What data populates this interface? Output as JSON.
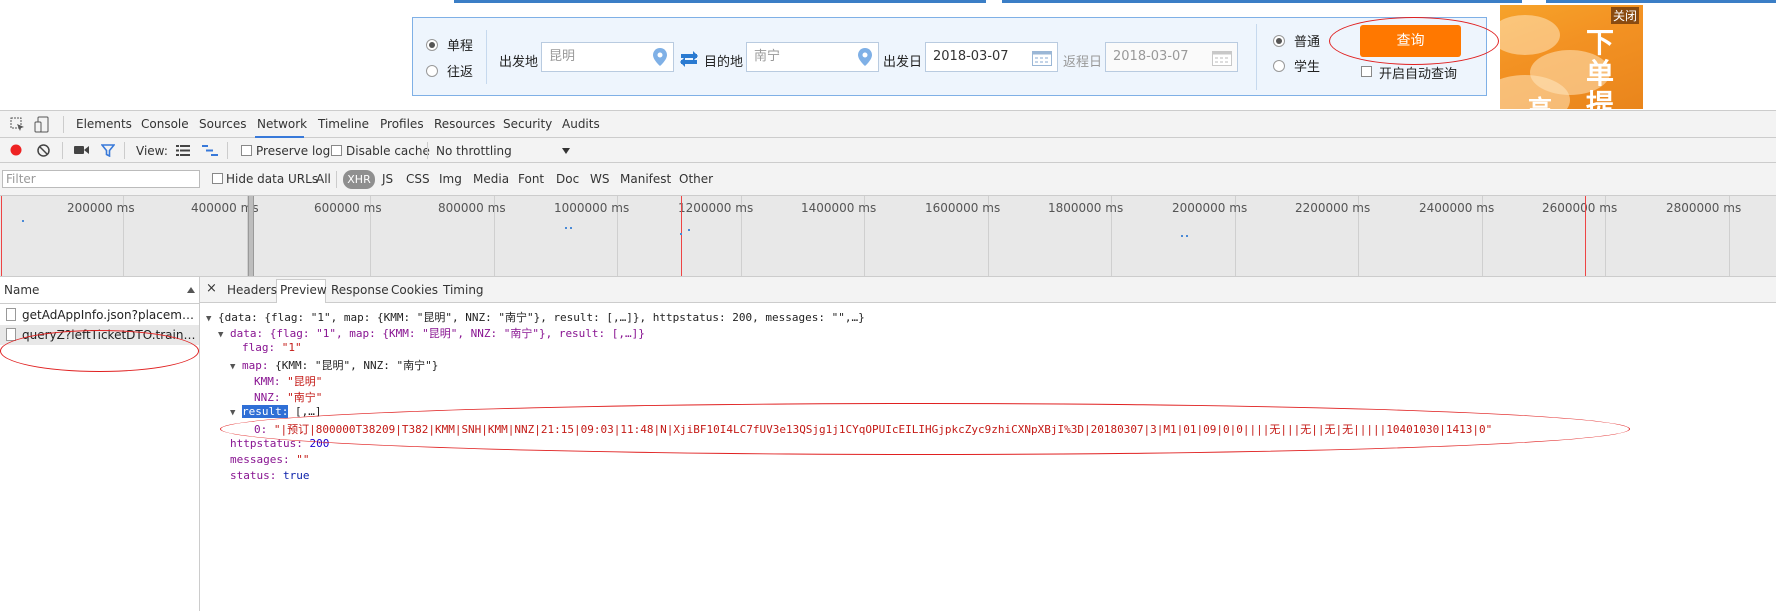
{
  "search": {
    "trip_one_way": "单程",
    "trip_round": "往返",
    "from_label": "出发地",
    "from_value": "昆明",
    "to_label": "目的地",
    "to_value": "南宁",
    "depart_label": "出发日",
    "depart_value": "2018-03-07",
    "return_label": "返程日",
    "return_value": "2018-03-07",
    "ticket_normal": "普通",
    "ticket_student": "学生",
    "query_label": "查询",
    "auto_query_label": "开启自动查询",
    "accent": "#ff7800"
  },
  "ad": {
    "close_label": "关闭",
    "text_1": "下",
    "text_2": "单",
    "text_3": "提",
    "text_4": "高"
  },
  "devtools": {
    "tabs": [
      "Elements",
      "Console",
      "Sources",
      "Network",
      "Timeline",
      "Profiles",
      "Resources",
      "Security",
      "Audits"
    ],
    "active_tab": "Network",
    "toolbar": {
      "view_label": "View:",
      "preserve_log": "Preserve log",
      "disable_cache": "Disable cache",
      "throttling": "No throttling"
    },
    "filter": {
      "placeholder": "Filter",
      "hide_data_urls": "Hide data URLs",
      "types": [
        "All",
        "XHR",
        "JS",
        "CSS",
        "Img",
        "Media",
        "Font",
        "Doc",
        "WS",
        "Manifest",
        "Other"
      ],
      "active_type": "XHR"
    },
    "timeline_ticks": [
      "200000 ms",
      "400000 ms",
      "600000 ms",
      "800000 ms",
      "1000000 ms",
      "1200000 ms",
      "1400000 ms",
      "1600000 ms",
      "1800000 ms",
      "2000000 ms",
      "2200000 ms",
      "2400000 ms",
      "2600000 ms",
      "2800000 ms"
    ],
    "name_header": "Name",
    "requests": [
      "getAdAppInfo.json?placement...",
      "queryZ?leftTicketDTO.train_dat..."
    ],
    "detail_tabs": [
      "Headers",
      "Preview",
      "Response",
      "Cookies",
      "Timing"
    ],
    "active_detail_tab": "Preview",
    "preview": {
      "line1": "{data: {flag: \"1\", map: {KMM: \"昆明\", NNZ: \"南宁\"}, result: [,…]}, httpstatus: 200, messages: \"\",…}",
      "line2": "data: {flag: \"1\", map: {KMM: \"昆明\", NNZ: \"南宁\"}, result: [,…]}",
      "flag_key": "flag:",
      "flag_val": "\"1\"",
      "map_key": "map:",
      "map_summary": "{KMM: \"昆明\", NNZ: \"南宁\"}",
      "kmm_key": "KMM:",
      "kmm_val": "\"昆明\"",
      "nnz_key": "NNZ:",
      "nnz_val": "\"南宁\"",
      "result_key": "result:",
      "result_summary": "[,…]",
      "result0_key": "0:",
      "result0_val": "\"|预订|800000T38209|T382|KMM|SNH|KMM|NNZ|21:15|09:03|11:48|N|XjiBF10I4LC7fUV3e13QSjg1j1CYqOPUIcEILIHGjpkcZyc9zhiCXNpXBjI%3D|20180307|3|M1|01|09|0|0||||无|||无||无|无|||||10401030|1413|0\"",
      "httpstatus_key": "httpstatus:",
      "httpstatus_val": "200",
      "messages_key": "messages:",
      "messages_val": "\"\"",
      "status_key": "status:",
      "status_val": "true"
    }
  }
}
